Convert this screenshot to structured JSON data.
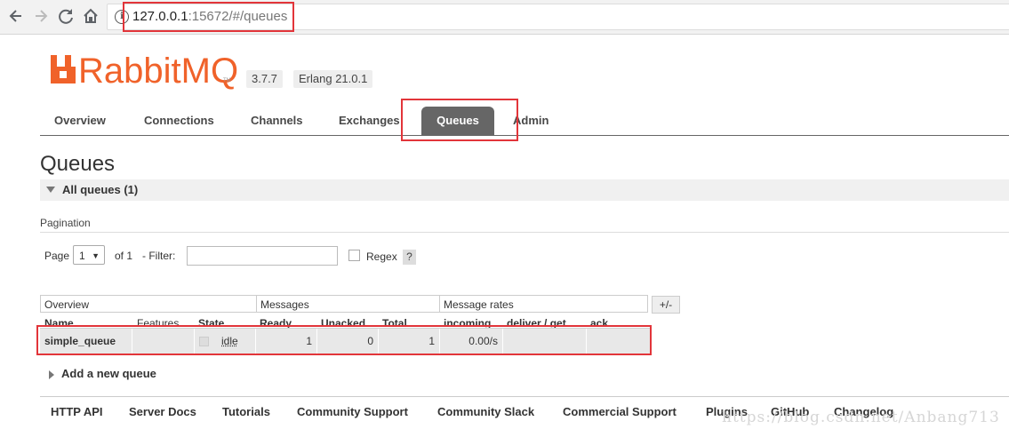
{
  "browser": {
    "url_host": "127.0.0.1",
    "url_rest": ":15672/#/queues",
    "back_icon": "arrow-left-icon",
    "forward_icon": "arrow-right-icon",
    "reload_icon": "reload-icon",
    "home_icon": "home-icon",
    "info_icon": "info-icon",
    "info_glyph": "i"
  },
  "header": {
    "logo_text": "RabbitMQ",
    "logo_tm": "TM",
    "version": "3.7.7",
    "erlang": "Erlang 21.0.1"
  },
  "tabs": [
    {
      "label": "Overview"
    },
    {
      "label": "Connections"
    },
    {
      "label": "Channels"
    },
    {
      "label": "Exchanges"
    },
    {
      "label": "Queues",
      "active": true
    },
    {
      "label": "Admin"
    }
  ],
  "page": {
    "title": "Queues",
    "section_label": "All queues (1)",
    "pagination_label": "Pagination",
    "page_label": "Page",
    "page_value": "1",
    "of_label": "of 1",
    "filter_label": "- Filter:",
    "filter_value": "",
    "regex_label": "Regex",
    "help_label": "?",
    "columns_toggle": "+/-",
    "add_queue_label": "Add a new queue"
  },
  "table": {
    "groups": [
      "Overview",
      "Messages",
      "Message rates"
    ],
    "headers": [
      "Name",
      "Features",
      "State",
      "Ready",
      "Unacked",
      "Total",
      "incoming",
      "deliver / get",
      "ack"
    ],
    "rows": [
      {
        "name": "simple_queue",
        "features": "",
        "state": "idle",
        "ready": "1",
        "unacked": "0",
        "total": "1",
        "incoming": "0.00/s",
        "deliver_get": "",
        "ack": ""
      }
    ]
  },
  "footer": {
    "links": [
      "HTTP API",
      "Server Docs",
      "Tutorials",
      "Community Support",
      "Community Slack",
      "Commercial Support",
      "Plugins",
      "GitHub",
      "Changelog"
    ]
  },
  "watermark": "https://blog.csdn.net/Anbang713",
  "colors": {
    "accent": "#f0622a",
    "highlight": "#e2353a",
    "active_tab": "#666666"
  }
}
